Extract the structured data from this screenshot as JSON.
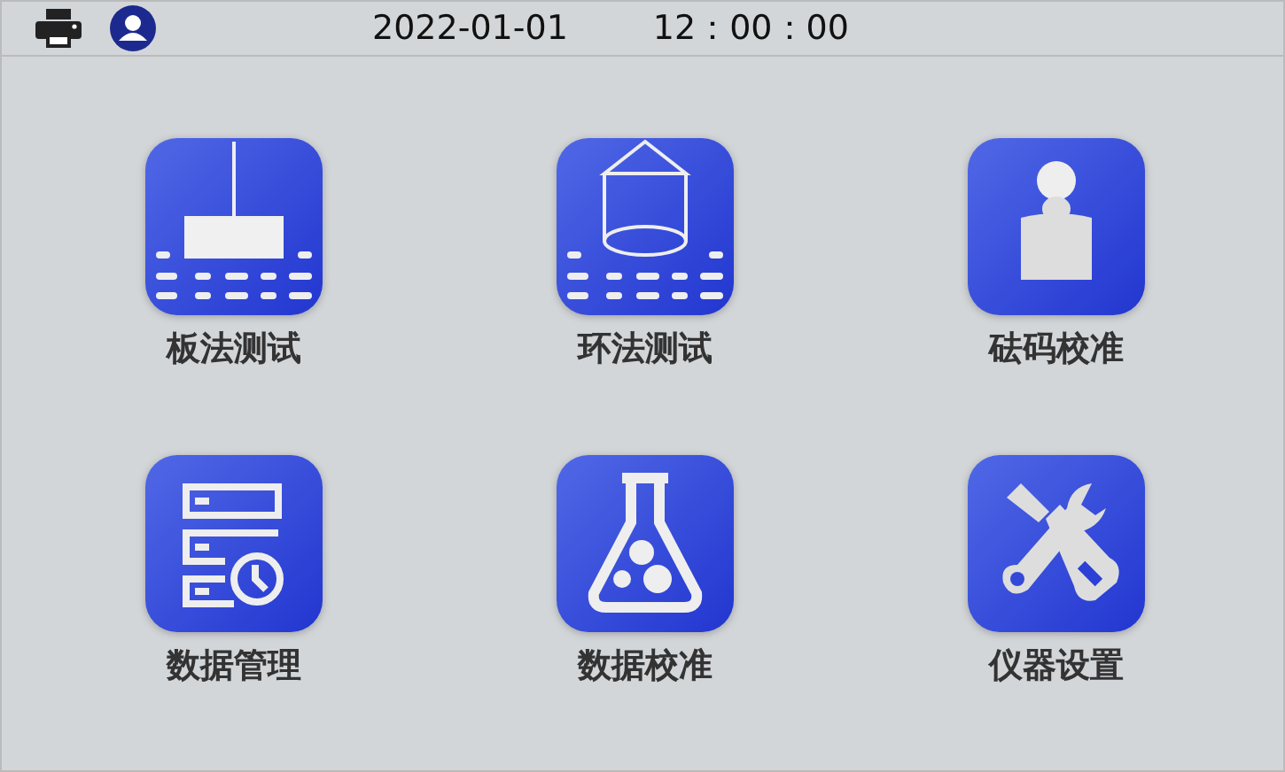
{
  "status_bar": {
    "date": "2022-01-01",
    "time": "12：00：00"
  },
  "menu": [
    {
      "kind": "plate",
      "label": "板法测试"
    },
    {
      "kind": "ring",
      "label": "环法测试"
    },
    {
      "kind": "weight",
      "label": "砝码校准"
    },
    {
      "kind": "data",
      "label": "数据管理"
    },
    {
      "kind": "flask",
      "label": "数据校准"
    },
    {
      "kind": "tools",
      "label": "仪器设置"
    }
  ]
}
